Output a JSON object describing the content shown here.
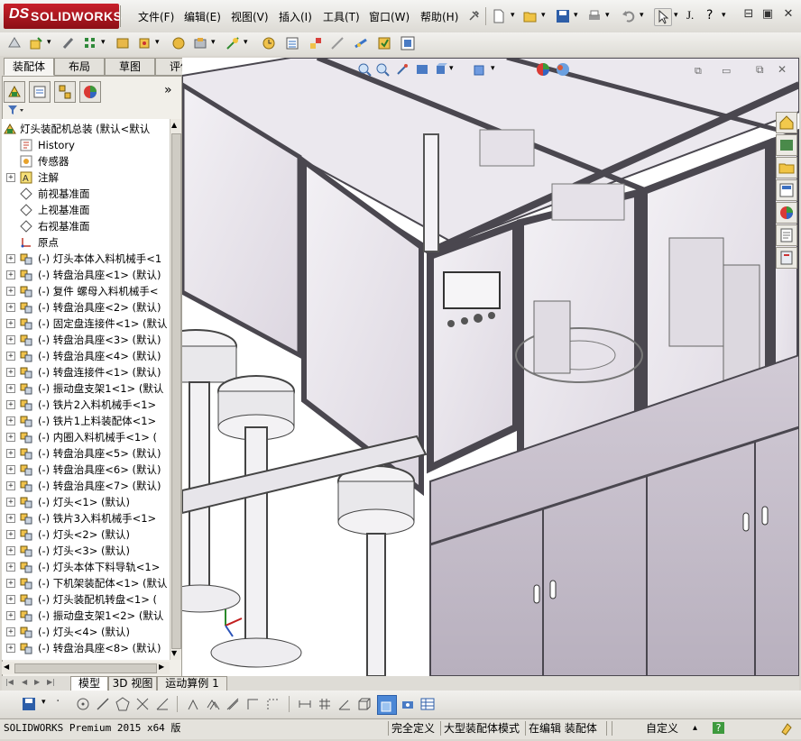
{
  "app": {
    "logo_prefix": "DS",
    "logo_name": "SOLIDWORKS"
  },
  "menu": [
    "文件(F)",
    "编辑(E)",
    "视图(V)",
    "插入(I)",
    "工具(T)",
    "窗口(W)",
    "帮助(H)"
  ],
  "window_controls": {
    "minimize": "⊟",
    "restore": "▣",
    "close": "✕"
  },
  "search_hint": "J.",
  "help_icon": "?",
  "tabs": [
    "装配体",
    "布局",
    "草图",
    "评估"
  ],
  "feature_tree": {
    "root": "灯头装配机总装  (默认<默认",
    "items": [
      {
        "text": "History",
        "icon": "history-icon",
        "expand": false
      },
      {
        "text": "传感器",
        "icon": "sensor-icon",
        "expand": false
      },
      {
        "text": "注解",
        "icon": "annotation-icon",
        "expand": true
      },
      {
        "text": "前视基准面",
        "icon": "plane-icon",
        "expand": false
      },
      {
        "text": "上视基准面",
        "icon": "plane-icon",
        "expand": false
      },
      {
        "text": "右视基准面",
        "icon": "plane-icon",
        "expand": false
      },
      {
        "text": "原点",
        "icon": "origin-icon",
        "expand": false
      },
      {
        "text": "(-) 灯头本体入料机械手<1",
        "icon": "assembly-icon",
        "expand": true
      },
      {
        "text": "(-) 转盘治具座<1> (默认)",
        "icon": "assembly-icon",
        "expand": true
      },
      {
        "text": "(-) 复件 螺母入料机械手<",
        "icon": "assembly-icon",
        "expand": true
      },
      {
        "text": "(-) 转盘治具座<2> (默认)",
        "icon": "assembly-icon",
        "expand": true
      },
      {
        "text": "(-) 固定盘连接件<1> (默认",
        "icon": "assembly-icon",
        "expand": true
      },
      {
        "text": "(-) 转盘治具座<3> (默认)",
        "icon": "assembly-icon",
        "expand": true
      },
      {
        "text": "(-) 转盘治具座<4> (默认)",
        "icon": "assembly-icon",
        "expand": true
      },
      {
        "text": "(-) 转盘连接件<1> (默认)",
        "icon": "assembly-icon",
        "expand": true
      },
      {
        "text": "(-) 振动盘支架1<1> (默认",
        "icon": "assembly-icon",
        "expand": true
      },
      {
        "text": "(-) 铁片2入料机械手<1>",
        "icon": "assembly-icon",
        "expand": true
      },
      {
        "text": "(-) 铁片1上料装配体<1>",
        "icon": "assembly-icon",
        "expand": true
      },
      {
        "text": "(-) 内圈入料机械手<1> (",
        "icon": "assembly-icon",
        "expand": true
      },
      {
        "text": "(-) 转盘治具座<5> (默认)",
        "icon": "assembly-icon",
        "expand": true
      },
      {
        "text": "(-) 转盘治具座<6> (默认)",
        "icon": "assembly-icon",
        "expand": true
      },
      {
        "text": "(-) 转盘治具座<7> (默认)",
        "icon": "assembly-icon",
        "expand": true
      },
      {
        "text": "(-) 灯头<1> (默认)",
        "icon": "assembly-icon",
        "expand": true
      },
      {
        "text": "(-) 铁片3入料机械手<1>",
        "icon": "assembly-icon",
        "expand": true
      },
      {
        "text": "(-) 灯头<2> (默认)",
        "icon": "assembly-icon",
        "expand": true
      },
      {
        "text": "(-) 灯头<3> (默认)",
        "icon": "assembly-icon",
        "expand": true
      },
      {
        "text": "(-) 灯头本体下料导轨<1>",
        "icon": "assembly-icon",
        "expand": true
      },
      {
        "text": "(-) 下机架装配体<1> (默认",
        "icon": "assembly-icon",
        "expand": true
      },
      {
        "text": "(-) 灯头装配机转盘<1> (",
        "icon": "assembly-icon",
        "expand": true
      },
      {
        "text": "(-) 振动盘支架1<2> (默认",
        "icon": "assembly-icon",
        "expand": true
      },
      {
        "text": "(-) 灯头<4> (默认)",
        "icon": "assembly-icon",
        "expand": true
      },
      {
        "text": "(-) 转盘治具座<8> (默认)",
        "icon": "assembly-icon",
        "expand": true
      }
    ]
  },
  "bottom_tabs": [
    "模型",
    "3D 视图",
    "运动算例 1"
  ],
  "status": {
    "product": "SOLIDWORKS Premium 2015 x64 版",
    "definition": "完全定义",
    "mode": "大型装配体模式",
    "editing": "在编辑 装配体",
    "units": "自定义",
    "units_arrow": "▴",
    "help": "?"
  },
  "colors": {
    "brand_red": "#b3141d",
    "chrome": "#dcdad4",
    "frame": "#5d5a62",
    "cabinet": "#c7c0cc"
  }
}
